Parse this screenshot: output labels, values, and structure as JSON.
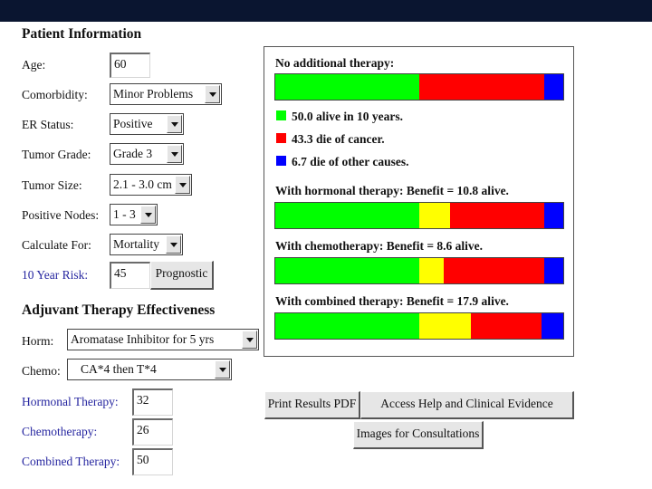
{
  "colors": {
    "alive": "#00ff00",
    "cancer": "#ff0000",
    "other": "#0000ff",
    "benefit": "#ffff00",
    "topbar": "#0a1530",
    "blue_label": "#2626a0"
  },
  "patient_info": {
    "heading": "Patient Information",
    "age_label": "Age:",
    "age_value": "60",
    "comorbidity_label": "Comorbidity:",
    "comorbidity_value": "Minor Problems",
    "er_label": "ER Status:",
    "er_value": "Positive",
    "grade_label": "Tumor Grade:",
    "grade_value": "Grade 3",
    "size_label": "Tumor Size:",
    "size_value": "2.1 - 3.0 cm",
    "nodes_label": "Positive Nodes:",
    "nodes_value": "1 - 3",
    "calc_label": "Calculate For:",
    "calc_value": "Mortality",
    "risk_label": "10 Year Risk:",
    "risk_value": "45",
    "prognostic_button": "Prognostic"
  },
  "adjuvant": {
    "heading": "Adjuvant Therapy Effectiveness",
    "horm_label": "Horm:",
    "horm_value": "Aromatase Inhibitor for 5 yrs",
    "chemo_label": "Chemo:",
    "chemo_value": "CA*4 then T*4",
    "hormonal_label": "Hormonal Therapy:",
    "hormonal_value": "32",
    "chemotherapy_label": "Chemotherapy:",
    "chemotherapy_value": "26",
    "combined_label": "Combined Therapy:",
    "combined_value": "50"
  },
  "results": {
    "no_therapy_title": "No additional therapy:",
    "legend": [
      {
        "text": "50.0 alive in 10 years.",
        "color": "#00ff00"
      },
      {
        "text": "43.3 die of cancer.",
        "color": "#ff0000"
      },
      {
        "text": "6.7 die of other causes.",
        "color": "#0000ff"
      }
    ],
    "hormonal_title": "With hormonal therapy:   Benefit = 10.8 alive.",
    "chemo_title": "With chemotherapy:   Benefit = 8.6 alive.",
    "combined_title": "With combined therapy:   Benefit = 17.9 alive.",
    "bars": {
      "none": {
        "alive": 50.0,
        "benefit": 0,
        "cancer": 43.3,
        "other": 6.7
      },
      "hormonal": {
        "alive": 50.0,
        "benefit": 10.8,
        "cancer": 32.5,
        "other": 6.7
      },
      "chemo": {
        "alive": 50.0,
        "benefit": 8.6,
        "cancer": 34.7,
        "other": 6.7
      },
      "combined": {
        "alive": 50.0,
        "benefit": 17.9,
        "cancer": 24.5,
        "other": 7.6
      }
    }
  },
  "buttons": {
    "print": "Print Results PDF",
    "help": "Access Help and Clinical Evidence",
    "images": "Images for Consultations"
  }
}
